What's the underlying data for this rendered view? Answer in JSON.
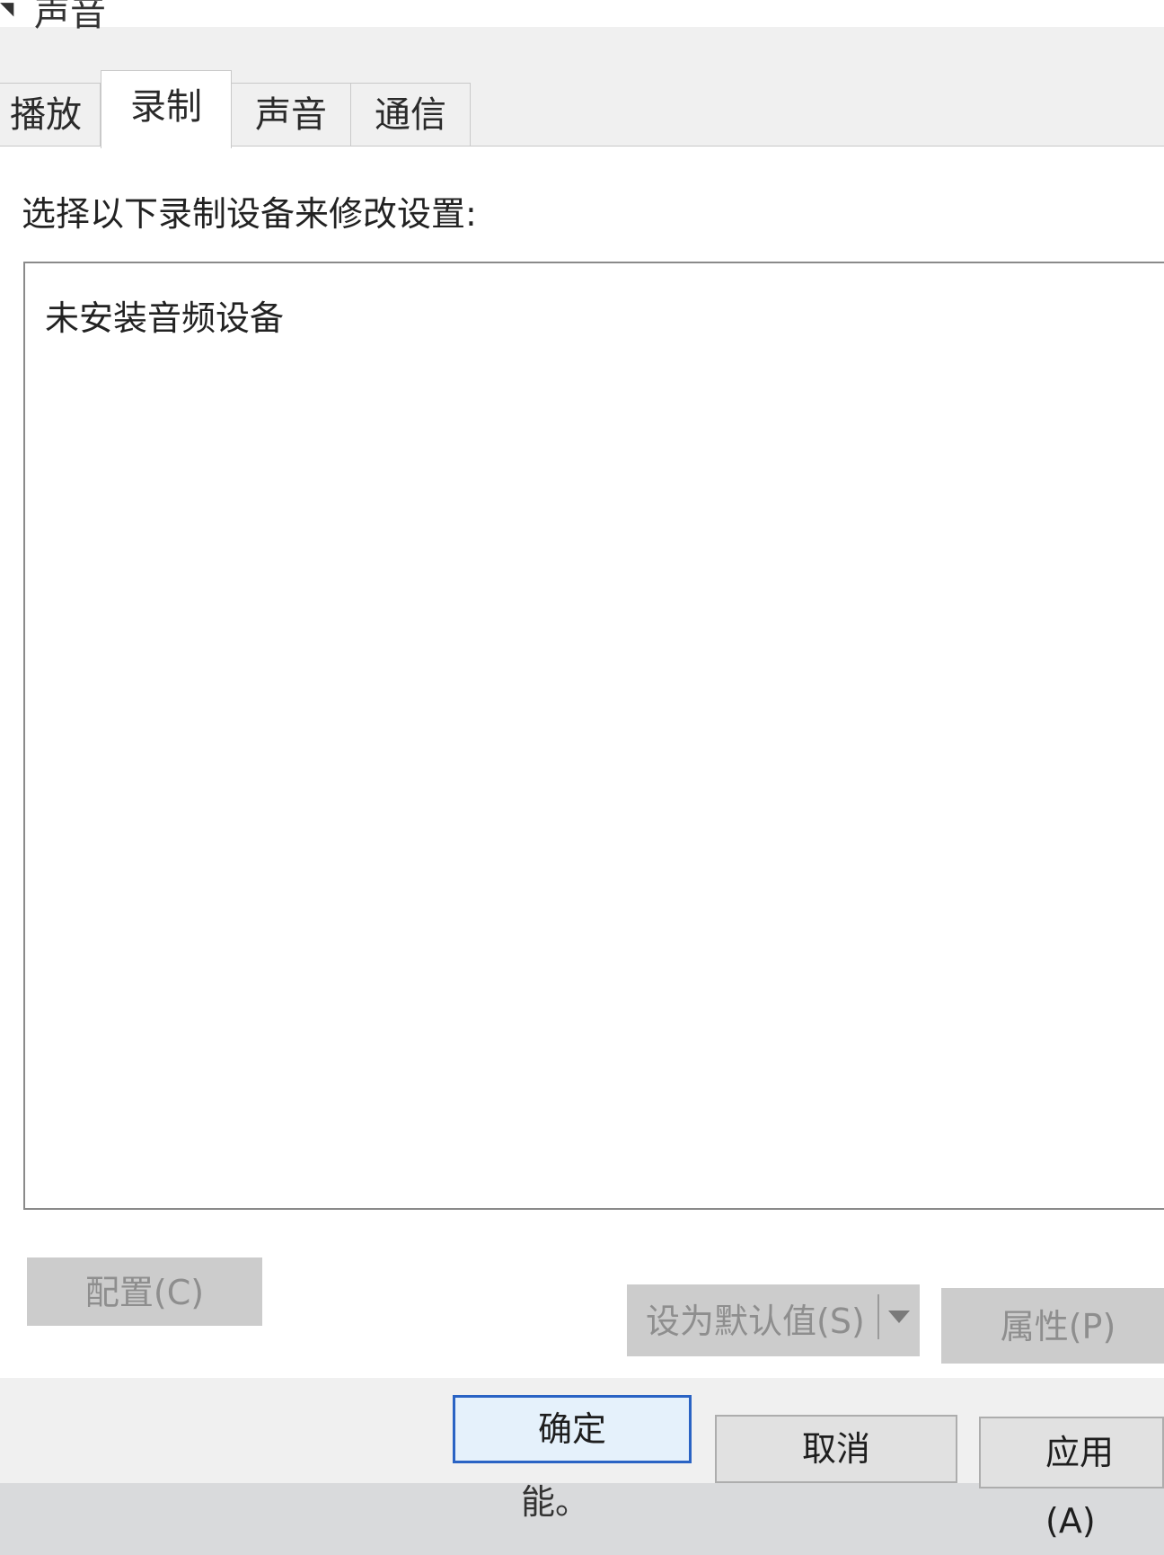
{
  "window": {
    "title": "声音"
  },
  "tabs": [
    {
      "label": "播放"
    },
    {
      "label": "录制"
    },
    {
      "label": "声音"
    },
    {
      "label": "通信"
    }
  ],
  "panel": {
    "instruction": "选择以下录制设备来修改设置:",
    "empty_message": "未安装音频设备"
  },
  "device_buttons": {
    "configure": "配置(C)",
    "set_default": "设为默认值(S)",
    "properties": "属性(P)"
  },
  "dialog_buttons": {
    "ok": "确定",
    "cancel": "取消",
    "apply": "应用(A)"
  },
  "background_text": "能。"
}
